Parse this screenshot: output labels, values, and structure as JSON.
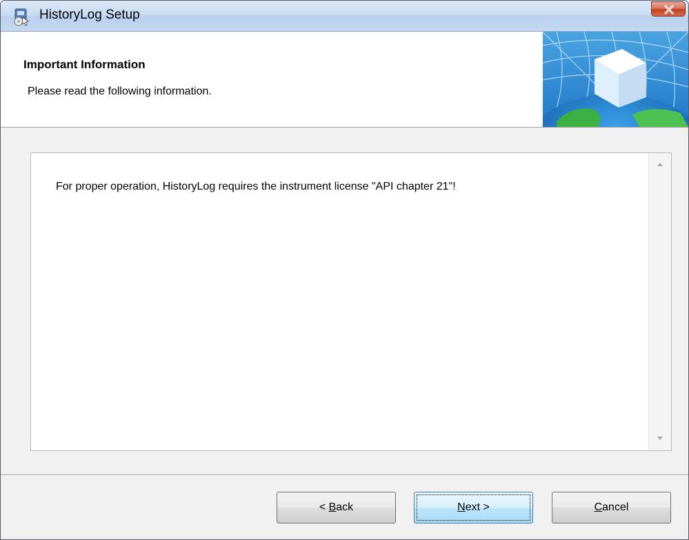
{
  "window": {
    "title": "HistoryLog Setup"
  },
  "header": {
    "title": "Important Information",
    "subtitle": "Please read the following information."
  },
  "content": {
    "text": "For proper operation, HistoryLog requires the instrument license \"API chapter 21\"!"
  },
  "buttons": {
    "back": {
      "prefix": "< ",
      "mnemonic": "B",
      "rest": "ack"
    },
    "next": {
      "prefix": "",
      "mnemonic": "N",
      "rest": "ext >"
    },
    "cancel": {
      "prefix": "",
      "mnemonic": "C",
      "rest": "ancel"
    }
  },
  "icons": {
    "app": "setup-installer-icon",
    "close": "close-icon",
    "header_graphic": "globe-cube-graphic",
    "scroll_up": "scroll-up-arrow-icon",
    "scroll_down": "scroll-down-arrow-icon"
  },
  "colors": {
    "titlebar": "#c9dcf2",
    "close_button": "#c2411f",
    "dialog_background": "#f0f0f0",
    "default_button_border": "#3c7fb1"
  }
}
